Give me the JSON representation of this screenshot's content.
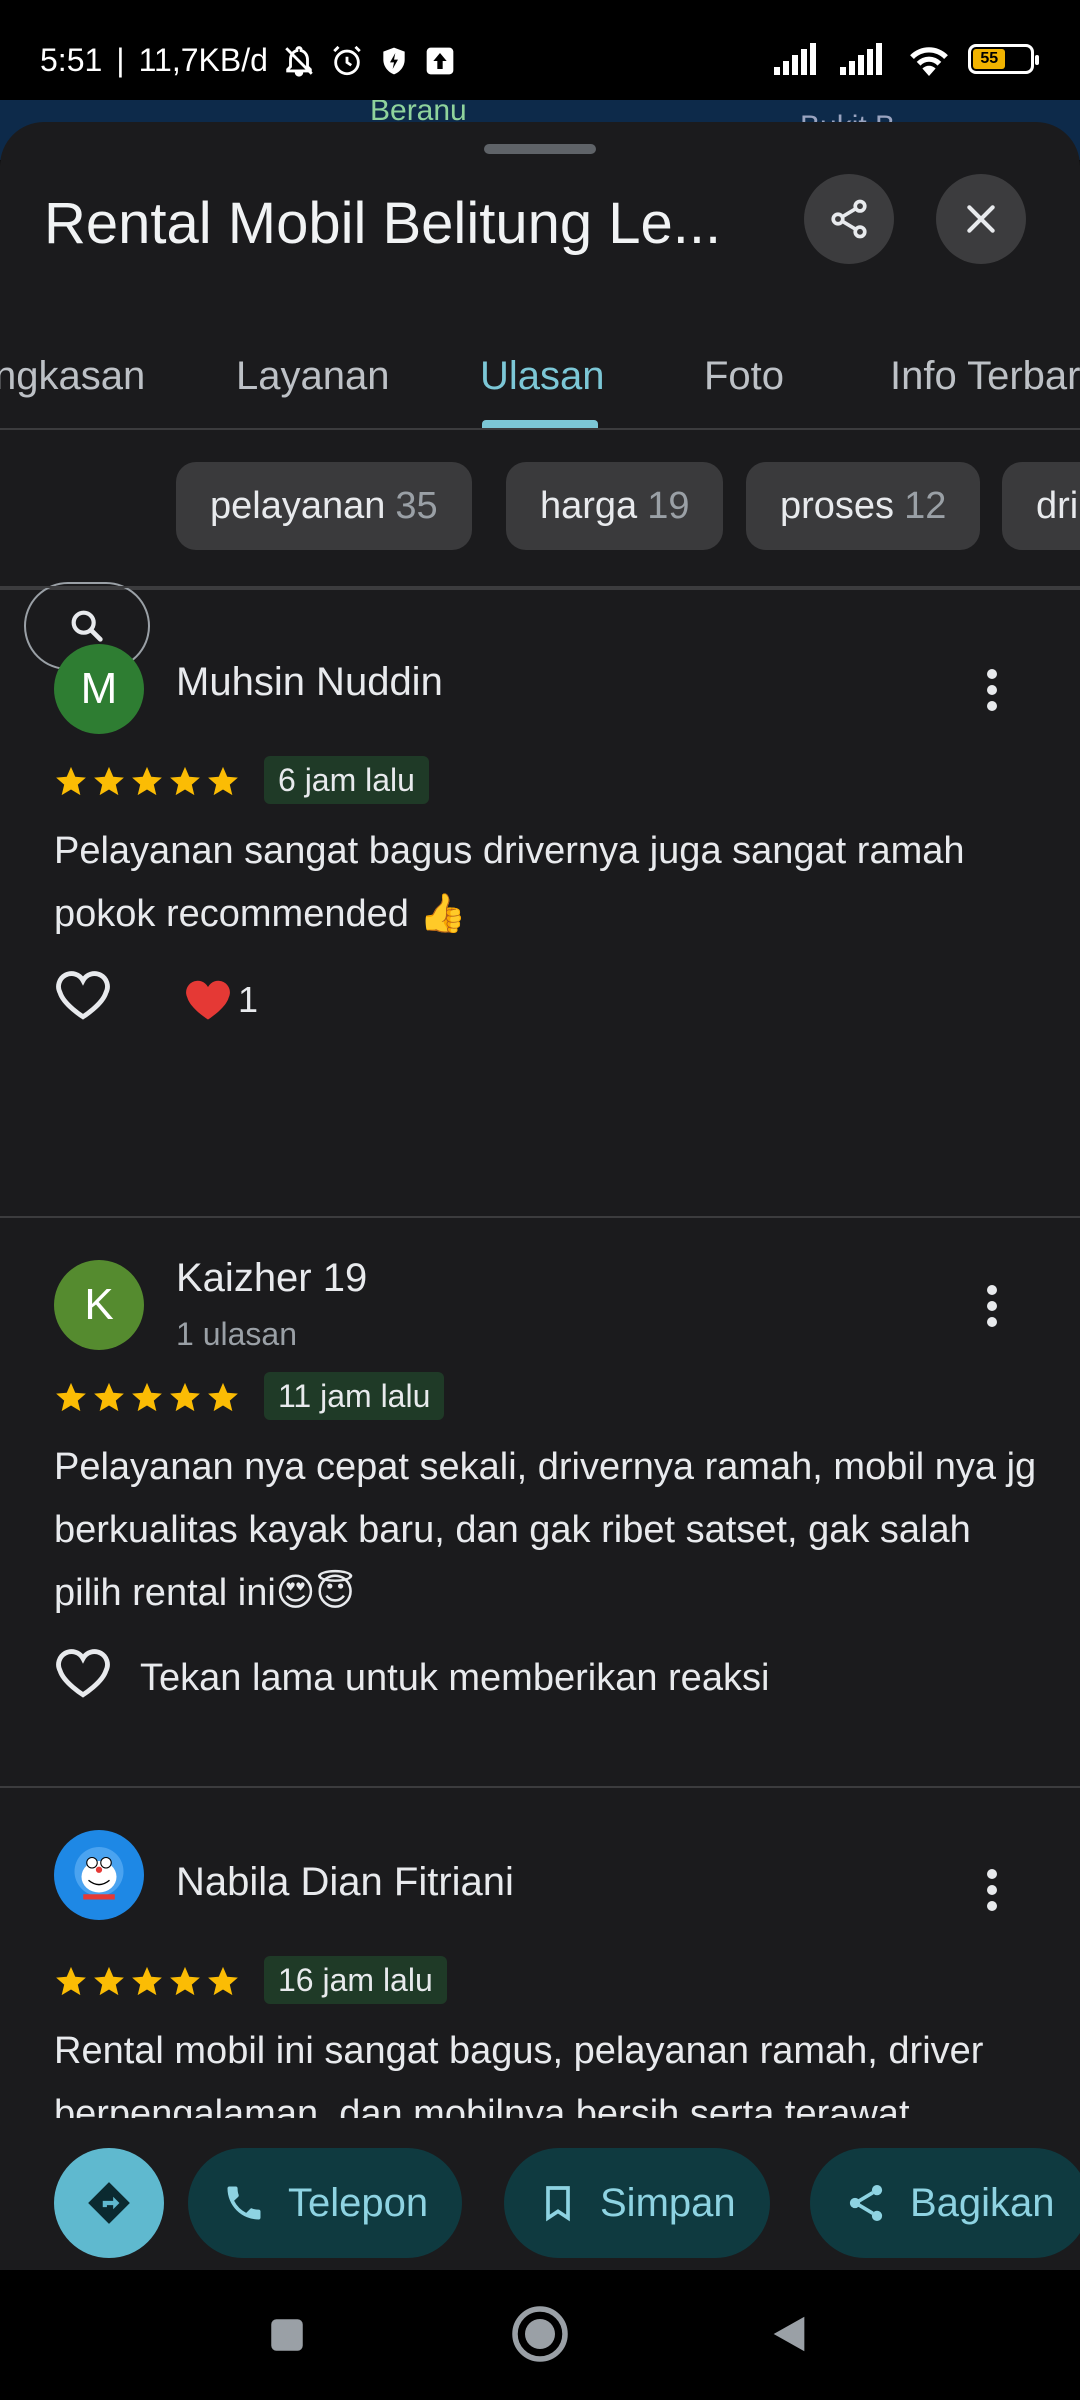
{
  "status_bar": {
    "time": "5:51",
    "speed": "11,7KB/d",
    "battery_level": "55",
    "battery_color": "#f1b300"
  },
  "map_peek": {
    "label_left": "Beranu",
    "label_right": "Bukit B..."
  },
  "header": {
    "title": "Rental Mobil Belitung Le...",
    "share_icon": "share-icon",
    "close_icon": "close-icon"
  },
  "tabs": [
    {
      "label": "Ringkasan",
      "visible_text": "ngkasan"
    },
    {
      "label": "Layanan"
    },
    {
      "label": "Ulasan",
      "active": true
    },
    {
      "label": "Foto"
    },
    {
      "label": "Info Terbaru",
      "visible_text": "Info Terbar"
    }
  ],
  "chips": [
    {
      "label": "pelayanan",
      "count": "35"
    },
    {
      "label": "harga",
      "count": "19"
    },
    {
      "label": "proses",
      "count": "12"
    },
    {
      "label": "dri"
    }
  ],
  "reviews": [
    {
      "initial": "M",
      "avatar_color": "#2e7d32",
      "name": "Muhsin Nuddin",
      "sub": "",
      "rating": 5,
      "time": "6 jam lalu",
      "text": "Pelayanan sangat bagus drivernya juga sangat ramah pokok recommended 👍",
      "reaction_count": "1"
    },
    {
      "initial": "K",
      "avatar_color": "#558b2f",
      "name": "Kaizher 19",
      "sub": "1 ulasan",
      "rating": 5,
      "time": "11 jam lalu",
      "text": "Pelayanan nya cepat sekali, drivernya ramah, mobil nya jg berkualitas kayak baru, dan gak ribet satset, gak salah pilih rental ini😍😇",
      "reaction_hint": "Tekan lama untuk memberikan reaksi"
    },
    {
      "initial": "",
      "avatar_color": "#1e88e5",
      "name": "Nabila Dian Fitriani",
      "sub": "",
      "rating": 5,
      "time": "16 jam lalu",
      "text": "Rental mobil ini sangat bagus, pelayanan ramah, driver berpengalaman, dan mobilnya bersih serta terawat dengan baik!"
    }
  ],
  "actions": {
    "directions_icon": "directions-icon",
    "call": "Telepon",
    "save": "Simpan",
    "share": "Bagikan",
    "accent": "#5fb9cf"
  }
}
